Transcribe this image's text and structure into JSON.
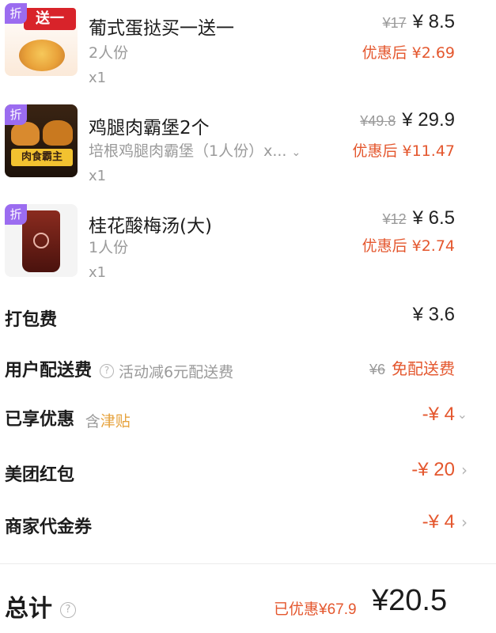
{
  "items": [
    {
      "name": "葡式蛋挞买一送一",
      "sub": "2人份",
      "qty": "x1",
      "badge": "折",
      "thumb_text": "送一",
      "original_price": "¥17",
      "price": "¥ 8.5",
      "after_discount": "优惠后 ¥2.69"
    },
    {
      "name": "鸡腿肉霸堡2个",
      "sub": "培根鸡腿肉霸堡（1人份）x...",
      "qty": "x1",
      "badge": "折",
      "thumb_text": "肉食霸主",
      "original_price": "¥49.8",
      "price": "¥ 29.9",
      "after_discount": "优惠后 ¥11.47"
    },
    {
      "name": "桂花酸梅汤(大)",
      "sub": "1人份",
      "qty": "x1",
      "badge": "折",
      "thumb_text": "",
      "original_price": "¥12",
      "price": "¥ 6.5",
      "after_discount": "优惠后 ¥2.74"
    }
  ],
  "fees": {
    "packing": {
      "label": "打包费",
      "value": "¥ 3.6"
    },
    "delivery": {
      "label": "用户配送费",
      "note": "活动减6元配送费",
      "original": "¥6",
      "value": "免配送费"
    },
    "enjoyed": {
      "label": "已享优惠",
      "note_prefix": "含",
      "note_highlight": "津贴",
      "value": "-¥ 4"
    },
    "redpacket": {
      "label": "美团红包",
      "value": "-¥ 20"
    },
    "voucher": {
      "label": "商家代金券",
      "value": "-¥ 4"
    }
  },
  "total": {
    "label": "总计",
    "saved": "已优惠¥67.9",
    "value": "¥20.5"
  },
  "colors": {
    "accent": "#e4572e",
    "badge": "#9b6cf0",
    "muted": "#9a9a9a"
  },
  "icons": {
    "help": "question-circle-icon",
    "chevron": "chevron-right-icon",
    "chevron_down": "chevron-down-icon"
  }
}
